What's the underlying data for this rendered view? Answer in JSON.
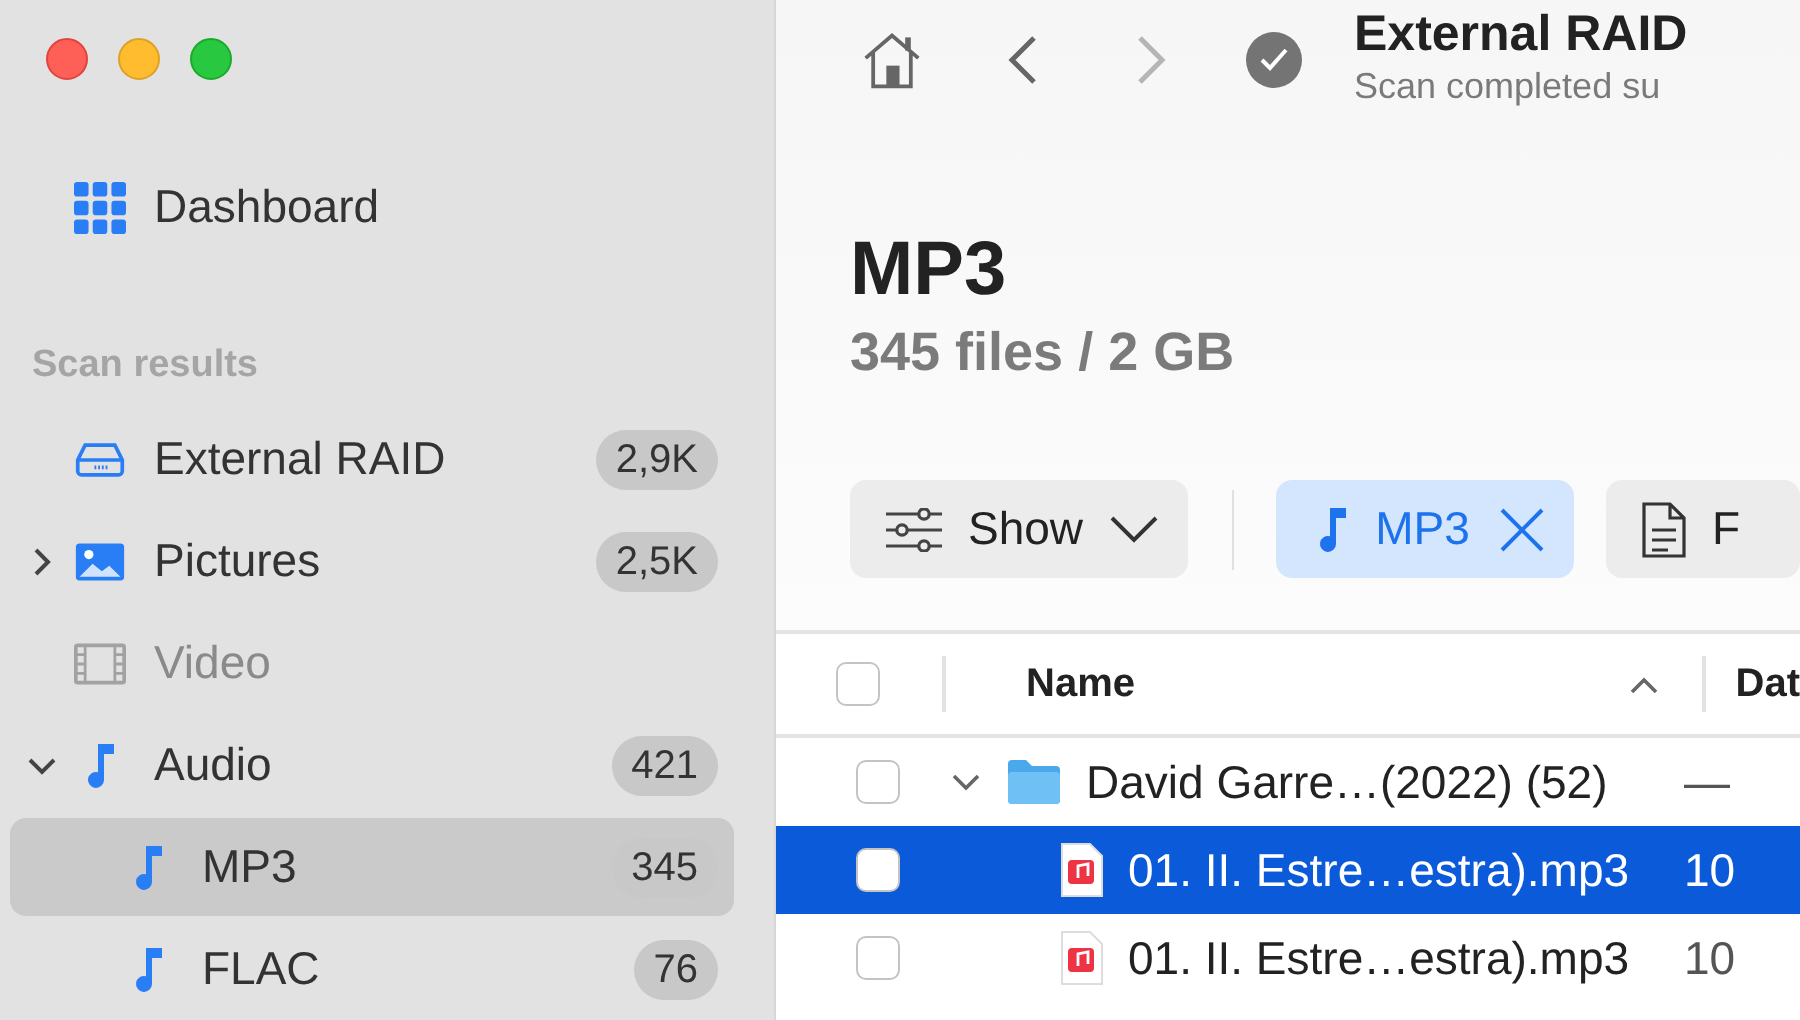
{
  "sidebar": {
    "dashboard": {
      "label": "Dashboard",
      "selected": false
    },
    "section_title": "Scan results",
    "items": [
      {
        "kind": "drive",
        "label": "External RAID",
        "count": "2,9K",
        "selected": false,
        "disabled": false
      },
      {
        "kind": "pictures",
        "label": "Pictures",
        "count": "2,5K",
        "selected": false,
        "disabled": false,
        "expanded": false
      },
      {
        "kind": "video",
        "label": "Video",
        "selected": false,
        "disabled": true
      },
      {
        "kind": "audio",
        "label": "Audio",
        "count": "421",
        "selected": false,
        "disabled": false,
        "expanded": true,
        "children": [
          {
            "kind": "audio",
            "label": "MP3",
            "count": "345",
            "selected": true,
            "disabled": false
          },
          {
            "kind": "audio",
            "label": "FLAC",
            "count": "76",
            "selected": false,
            "disabled": false
          }
        ]
      }
    ]
  },
  "toolbar": {
    "nav": [
      {
        "kind": "home",
        "disabled": false
      },
      {
        "kind": "back",
        "disabled": false
      },
      {
        "kind": "forward",
        "disabled": true
      }
    ],
    "status": {
      "kind": "complete",
      "title": "External RAID",
      "subtitle": "Scan completed su"
    }
  },
  "content": {
    "title": "MP3",
    "summary": "345 files / 2 GB"
  },
  "filters": [
    {
      "kind": "show",
      "label": "Show"
    },
    {
      "kind": "chip",
      "label": "MP3"
    },
    {
      "kind": "file",
      "label": "F"
    }
  ],
  "table": {
    "select_all_checked": false,
    "columns": [
      {
        "label": "Name",
        "sort_ascending": true
      },
      {
        "label": "Dat"
      }
    ],
    "rows": [
      {
        "kind": "folder",
        "name": "David Garre…(2022) (52)",
        "date": "—",
        "checked": false,
        "selected": false,
        "expanded": true,
        "children": [
          {
            "kind": "audio-file",
            "name": "01. II. Estre…estra).mp3",
            "date": "10",
            "checked": false,
            "selected": true
          },
          {
            "kind": "audio-file",
            "name": "01. II. Estre…estra).mp3",
            "date": "10",
            "checked": false,
            "selected": false
          }
        ]
      }
    ]
  }
}
